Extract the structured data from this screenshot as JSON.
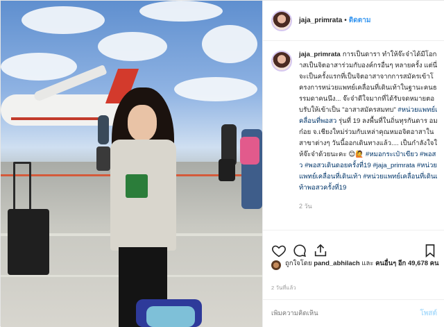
{
  "post": {
    "author": "jaja_primrata",
    "follow_label": "ติดตาม",
    "separator": "•",
    "caption_parts": [
      {
        "t": "การเป็นดารา ทำให้จ๊ะจ๋าได้มีโอกาสเป็นจิตอาสาร่วมกับองค์กรอื่นๆ หลายครั้ง แต่นี่จะเป็นครั้งแรกที่เป็นจิตอาสาจากการสมัครเข้าโครงการหน่วยแพทย์เคลื่อนที่เดินเท้าในฐานะคนธรรมดาคนนึง... จ๊ะจ๋าดีใจมากที่ได้รับจดหมายตอบรับให้เข้าเป็น ",
        "tag": false
      },
      {
        "t": "\"อาสาสมัครสมทบ\"",
        "tag": false
      },
      {
        "t": " ",
        "tag": false
      },
      {
        "t": "#หน่วยแพทย์เคลื่อนที่พอสว",
        "tag": true
      },
      {
        "t": " รุ่นที่ 19 ลงพื้นที่ในถิ่นทุรกันดาร อมก๋อย จ.เชียงใหม่ร่วมกับเหล่าคุณหมอจิตอาสาในสาขาต่างๆ วันนี้ออกเดินทางแล้ว.... เป็นกำลังใจให้จ๊ะจ๋าด้วยนะคะ 😊🙋 ",
        "tag": false
      },
      {
        "t": "#หมอกระเป๋าเขียว",
        "tag": true
      },
      {
        "t": " ",
        "tag": false
      },
      {
        "t": "#พอสว",
        "tag": true
      },
      {
        "t": " ",
        "tag": false
      },
      {
        "t": "#พอสวเดินดอยครั้งที่19",
        "tag": true
      },
      {
        "t": " ",
        "tag": false
      },
      {
        "t": "#jaja_primrata",
        "tag": true
      },
      {
        "t": " ",
        "tag": false
      },
      {
        "t": "#หน่วยแพทย์เคลื่อนที่เดินเท้า",
        "tag": true
      },
      {
        "t": " ",
        "tag": false
      },
      {
        "t": "#หน่วยแพทย์เคลื่อนที่เดินเท้าพอสวครั้งที่19",
        "tag": true
      }
    ],
    "comment_age": "2 วัน",
    "likes_prefix": "ถูกใจโดย",
    "likes_user": "pand_abhilach",
    "likes_and": "และ",
    "likes_others": "คนอื่นๆ อีก 49,678 คน",
    "date_label": "2 วันที่แล้ว",
    "add_comment_placeholder": "เพิ่มความคิดเห็น",
    "post_button": "โพสต์"
  },
  "icons": {
    "like": "heart-icon",
    "comment": "speech-bubble-icon",
    "share": "share-icon",
    "save": "bookmark-icon"
  },
  "colors": {
    "link": "#3897f0",
    "hashtag": "#003569",
    "post_disabled": "#b2dffc"
  }
}
